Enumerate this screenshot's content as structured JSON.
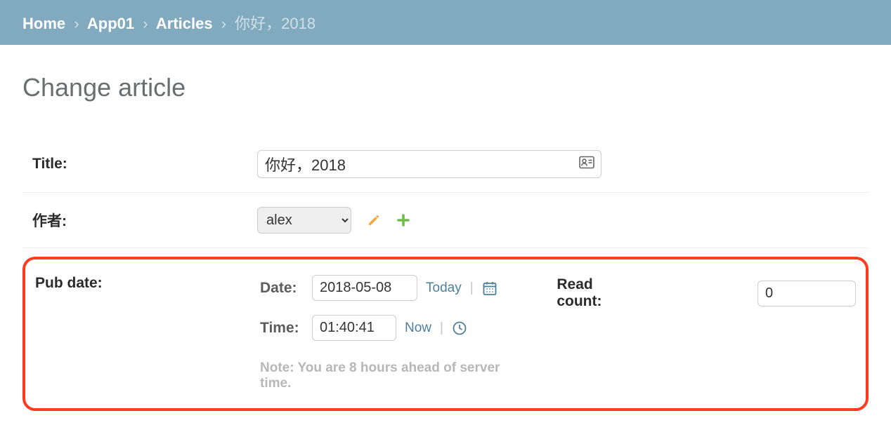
{
  "breadcrumb": {
    "home": "Home",
    "app": "App01",
    "model": "Articles",
    "current": "你好，2018"
  },
  "page_title": "Change article",
  "fields": {
    "title_label": "Title:",
    "title_value": "你好，2018",
    "author_label": "作者:",
    "author_value": "alex",
    "pubdate_label": "Pub date:",
    "date_sub_label": "Date:",
    "date_value": "2018-05-08",
    "today_link": "Today",
    "time_sub_label": "Time:",
    "time_value": "01:40:41",
    "now_link": "Now",
    "note": "Note: You are 8 hours ahead of server time.",
    "readcount_label": "Read count:",
    "readcount_value": "0"
  }
}
